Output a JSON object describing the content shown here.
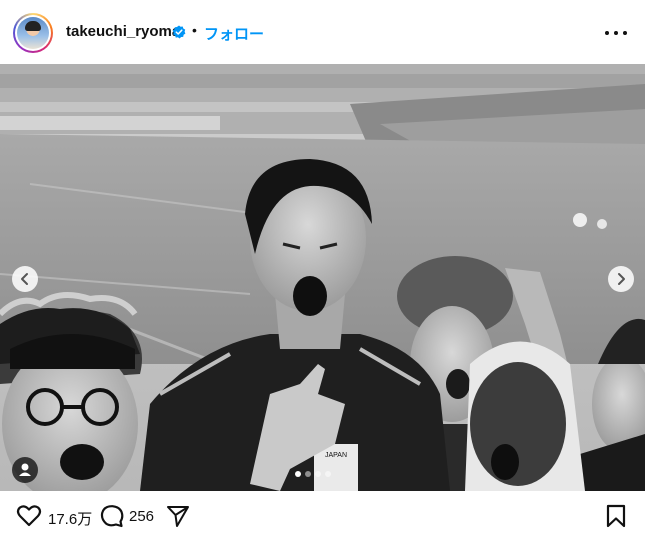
{
  "post": {
    "username": "takeuchi_ryoma",
    "follow_label": "フォロー",
    "separator": "•"
  },
  "photo": {
    "slide_total": 4,
    "slide_active": 1,
    "jersey_text": "JAPAN"
  },
  "actions": {
    "likes": "17.6万",
    "comments": "256"
  },
  "icons": {
    "verified": "verified-badge-icon",
    "more": "more-options-icon",
    "like": "heart-icon",
    "comment": "comment-icon",
    "share": "send-icon",
    "save": "bookmark-icon",
    "tag": "user-tag-icon",
    "prev": "chevron-left-icon",
    "next": "chevron-right-icon"
  },
  "colors": {
    "follow": "#0095f6",
    "verified": "#0095f6"
  }
}
